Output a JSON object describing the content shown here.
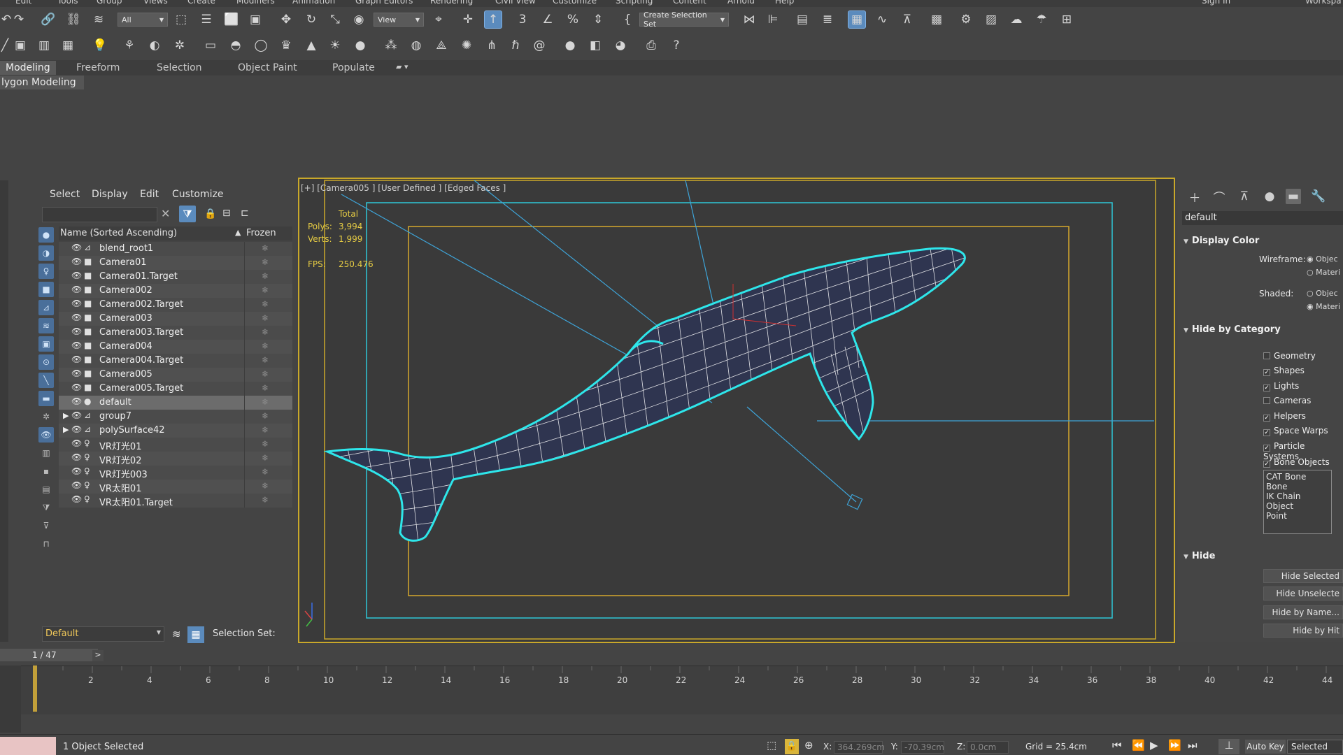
{
  "menubar": {
    "items": [
      "Edit",
      "Tools",
      "Group",
      "Views",
      "Create",
      "Modifiers",
      "Animation",
      "Graph Editors",
      "Rendering",
      "Civil View",
      "Customize",
      "Scripting",
      "Content",
      "Arnold",
      "Help"
    ],
    "sign_in": "Sign In",
    "workspace": "Workspa"
  },
  "toolbar": {
    "filter_select": "All",
    "view_select": "View",
    "create_selection_set": "Create Selection Set"
  },
  "ribbon": {
    "tabs": [
      "Modeling",
      "Freeform",
      "Selection",
      "Object Paint",
      "Populate"
    ],
    "active_tab": "Modeling",
    "subtab": "lygon Modeling"
  },
  "explorer": {
    "menu": [
      "Select",
      "Display",
      "Edit",
      "Customize"
    ],
    "header_name": "Name (Sorted Ascending)",
    "header_sort": "▲",
    "header_frozen": "Frozen",
    "rows": [
      {
        "name": "blend_root1",
        "expand": "",
        "type_icon": "bone-icon",
        "type": "⊿"
      },
      {
        "name": "Camera01",
        "expand": "",
        "type_icon": "camera-icon",
        "type": "■"
      },
      {
        "name": "Camera01.Target",
        "expand": "",
        "type_icon": "camera-icon",
        "type": "■"
      },
      {
        "name": "Camera002",
        "expand": "",
        "type_icon": "camera-icon",
        "type": "■"
      },
      {
        "name": "Camera002.Target",
        "expand": "",
        "type_icon": "camera-icon",
        "type": "■"
      },
      {
        "name": "Camera003",
        "expand": "",
        "type_icon": "camera-icon",
        "type": "■"
      },
      {
        "name": "Camera003.Target",
        "expand": "",
        "type_icon": "camera-icon",
        "type": "■"
      },
      {
        "name": "Camera004",
        "expand": "",
        "type_icon": "camera-icon",
        "type": "■"
      },
      {
        "name": "Camera004.Target",
        "expand": "",
        "type_icon": "camera-icon",
        "type": "■"
      },
      {
        "name": "Camera005",
        "expand": "",
        "type_icon": "camera-icon",
        "type": "■"
      },
      {
        "name": "Camera005.Target",
        "expand": "",
        "type_icon": "camera-icon",
        "type": "■"
      },
      {
        "name": "default",
        "expand": "",
        "type_icon": "geometry-icon",
        "type": "●"
      },
      {
        "name": "group7",
        "expand": "▶",
        "type_icon": "bone-icon",
        "type": "⊿"
      },
      {
        "name": "polySurface42",
        "expand": "▶",
        "type_icon": "bone-icon",
        "type": "⊿"
      },
      {
        "name": "VR灯光01",
        "expand": "",
        "type_icon": "light-icon",
        "type": "♀"
      },
      {
        "name": "VR灯光02",
        "expand": "",
        "type_icon": "light-icon",
        "type": "♀"
      },
      {
        "name": "VR灯光003",
        "expand": "",
        "type_icon": "light-icon",
        "type": "♀"
      },
      {
        "name": "VR太阳01",
        "expand": "",
        "type_icon": "light-icon",
        "type": "♀"
      },
      {
        "name": "VR太阳01.Target",
        "expand": "",
        "type_icon": "light-icon",
        "type": "♀"
      }
    ],
    "selected_row": "default",
    "layer": "Default",
    "selection_set_label": "Selection Set:"
  },
  "viewport": {
    "label": "[+] [Camera005 ] [User Defined ] [Edged Faces ]",
    "stats_total": "Total",
    "polys_label": "Polys:",
    "polys_value": "3,994",
    "verts_label": "Verts:",
    "verts_value": "1,999",
    "fps_label": "FPS:",
    "fps_value": "250.476"
  },
  "command_panel": {
    "object_name": "default",
    "display_color": {
      "title": "Display Color",
      "wireframe_label": "Wireframe:",
      "shaded_label": "Shaded:",
      "opt_object": "Objec",
      "opt_material": "Materi"
    },
    "hide_by_category": {
      "title": "Hide by Category",
      "items": [
        {
          "label": "Geometry",
          "checked": false
        },
        {
          "label": "Shapes",
          "checked": true
        },
        {
          "label": "Lights",
          "checked": true
        },
        {
          "label": "Cameras",
          "checked": false
        },
        {
          "label": "Helpers",
          "checked": true
        },
        {
          "label": "Space Warps",
          "checked": true
        },
        {
          "label": "Particle Systems",
          "checked": true
        },
        {
          "label": "Bone Objects",
          "checked": true
        }
      ],
      "list": [
        "CAT Bone",
        "Bone",
        "IK Chain Object",
        "Point"
      ]
    },
    "hide": {
      "title": "Hide",
      "buttons": [
        "Hide Selected",
        "Hide Unselecte",
        "Hide by Name...",
        "Hide by Hit"
      ]
    }
  },
  "timeline": {
    "counter": "1 / 47",
    "next": ">",
    "ticks": [
      "2",
      "4",
      "6",
      "8",
      "10",
      "12",
      "14",
      "16",
      "18",
      "20",
      "22",
      "24",
      "26",
      "28",
      "30",
      "32",
      "34",
      "36",
      "38",
      "40",
      "42",
      "44"
    ]
  },
  "statusbar": {
    "status": "1 Object Selected",
    "x_label": "X:",
    "x_value": "364.269cm",
    "y_label": "Y:",
    "y_value": "-70.39cm",
    "z_label": "Z:",
    "z_value": "0.0cm",
    "grid": "Grid = 25.4cm",
    "autokey": "Auto Key",
    "selected": "Selected"
  },
  "colors": {
    "viewport_border": "#c9a82a",
    "wire_cyan": "#2ee6ea",
    "safe_frame": "#d4a82c",
    "accent_blue": "#5b8bbd",
    "stats_yellow": "#e6cc44"
  }
}
